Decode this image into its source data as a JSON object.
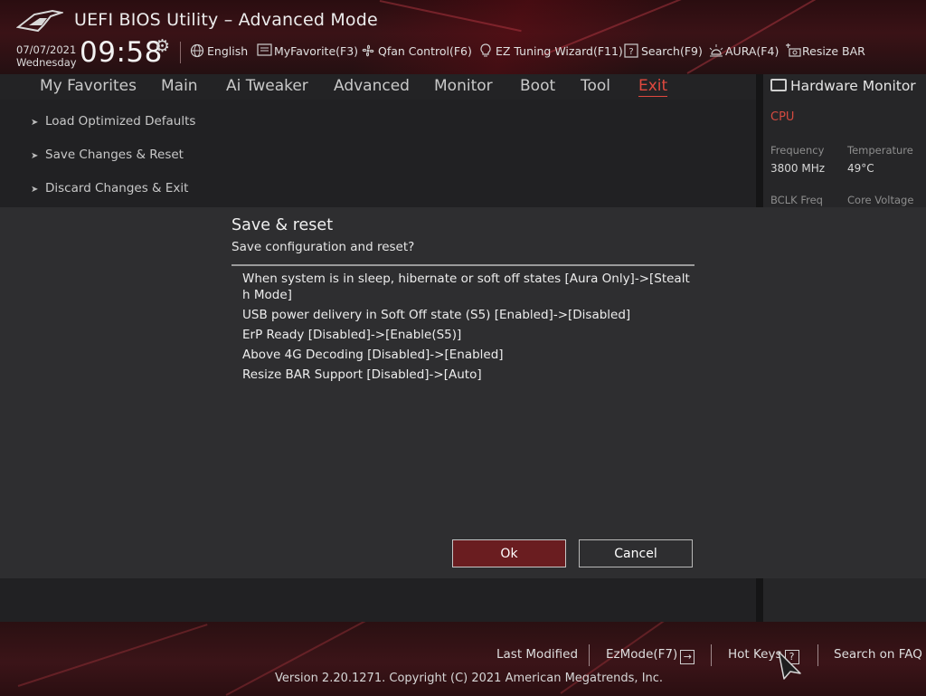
{
  "app": {
    "title": "UEFI BIOS Utility – Advanced Mode"
  },
  "status": {
    "date": "07/07/2021",
    "day": "Wednesday",
    "time": "09:58"
  },
  "toolbar": [
    {
      "label": "English",
      "icon": "globe-icon"
    },
    {
      "label": "MyFavorite(F3)",
      "icon": "favorite-list-icon"
    },
    {
      "label": "Qfan Control(F6)",
      "icon": "fan-icon"
    },
    {
      "label": "EZ Tuning Wizard(F11)",
      "icon": "lightbulb-icon"
    },
    {
      "label": "Search(F9)",
      "icon": "question-box-icon"
    },
    {
      "label": "AURA(F4)",
      "icon": "aura-light-icon"
    },
    {
      "label": "Resize BAR",
      "icon": "resize-bar-icon"
    }
  ],
  "tabs": [
    "My Favorites",
    "Main",
    "Ai Tweaker",
    "Advanced",
    "Monitor",
    "Boot",
    "Tool",
    "Exit"
  ],
  "active_tab": "Exit",
  "menu": [
    "Load Optimized Defaults",
    "Save Changes & Reset",
    "Discard Changes & Exit"
  ],
  "hardware_monitor": {
    "title": "Hardware Monitor",
    "section": "CPU",
    "frequency_label": "Frequency",
    "frequency_value": "3800 MHz",
    "temperature_label": "Temperature",
    "temperature_value": "49°C",
    "bclk_label": "BCLK Freq",
    "voltage_label": "Core Voltage"
  },
  "dialog": {
    "title": "Save & reset",
    "subtitle": "Save configuration and reset?",
    "changes": [
      "When system is in sleep, hibernate or soft off states [Aura Only]->[Stealth Mode]",
      "USB power delivery in Soft Off state (S5) [Enabled]->[Disabled]",
      "ErP Ready [Disabled]->[Enable(S5)]",
      "Above 4G Decoding [Disabled]->[Enabled]",
      "Resize BAR Support [Disabled]->[Auto]"
    ],
    "ok_label": "Ok",
    "cancel_label": "Cancel"
  },
  "footer": {
    "last_modified": "Last Modified",
    "ezmode": "EzMode(F7)",
    "hotkeys": "Hot Keys",
    "faq": "Search on FAQ",
    "copyright": "Version 2.20.1271. Copyright (C) 2021 American Megatrends, Inc."
  },
  "colors": {
    "accent": "#e0493f",
    "ok_button": "#6a1d20",
    "header": "#3a1216"
  }
}
